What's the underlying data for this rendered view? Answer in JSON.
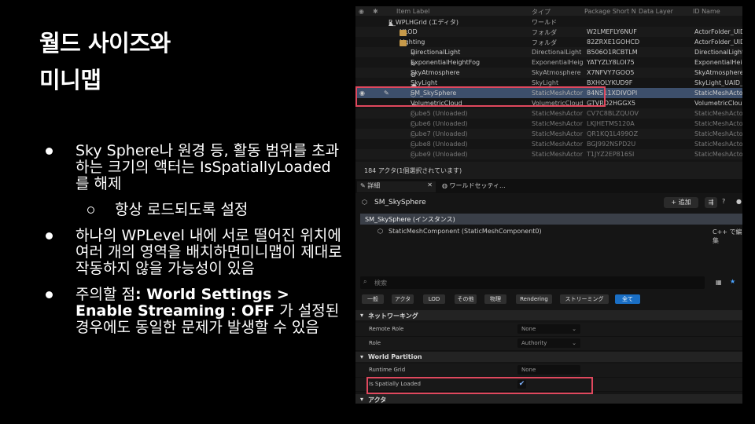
{
  "slide": {
    "title_line1": "월드 사이즈와",
    "title_line2": "미니맵",
    "bullets": [
      {
        "text": "Sky Sphere나 원경 등, 활동 범위를 초과하는 크기의 액터는 IsSpatiallyLoaded를 해제"
      },
      {
        "text": "항상 로드되도록 설정"
      },
      {
        "text": "하나의 WPLevel 내에 서로 떨어진 위치에 여러 개의 영역을 배치하면미니맵이 제대로 작동하지 않을 가능성이 있음"
      },
      {
        "prefix": "주의할 점",
        "bold": ": World Settings > Enable Streaming : OFF",
        "suffix": " 가 설정된 경우에도 동일한 문제가 발생할 수 있음"
      }
    ]
  },
  "editor": {
    "outliner": {
      "headers": {
        "label": "Item Label",
        "type": "タイプ",
        "pkg": "Package Short N",
        "layer": "Data Layer",
        "id": "ID Name"
      },
      "rows": [
        {
          "label": "P_WPLHGrid (エディタ)",
          "type": "ワールド",
          "pkg": "",
          "id": "",
          "indent": 1,
          "icon": "world-icon"
        },
        {
          "label": "HLOD",
          "type": "フォルダ",
          "pkg": "W2LMEFLY6NUF",
          "id": "ActorFolder_UID",
          "indent": 2,
          "icon": "folder-icon"
        },
        {
          "label": "Lighting",
          "type": "フォルダ",
          "pkg": "82ZRXE1GOHCD",
          "id": "ActorFolder_UID",
          "indent": 2,
          "icon": "folder-icon"
        },
        {
          "label": "DirectionalLight",
          "type": "DirectionalLight",
          "pkg": "B506O1RCBTLM",
          "id": "DirectionalLight",
          "indent": 3,
          "icon": "light-icon"
        },
        {
          "label": "ExponentialHeightFog",
          "type": "ExponentialHeig",
          "pkg": "YATYZLY8LOI75",
          "id": "ExponentialHeig",
          "indent": 3,
          "icon": "fog-icon"
        },
        {
          "label": "SkyAtmosphere",
          "type": "SkyAtmosphere",
          "pkg": "X7NFVY7GOO5",
          "id": "SkyAtmosphere",
          "indent": 3,
          "icon": "sky-icon"
        },
        {
          "label": "SkyLight",
          "type": "SkyLight",
          "pkg": "BXHOLYKUD9F",
          "id": "SkyLight_UAID_",
          "indent": 3,
          "icon": "skylight-icon"
        },
        {
          "label": "SM_SkySphere",
          "type": "StaticMeshActor",
          "pkg": "84NS11XDIVOPI",
          "id": "StaticMeshActor",
          "indent": 3,
          "icon": "mesh-icon",
          "selected": true
        },
        {
          "label": "VolumetricCloud",
          "type": "VolumetricCloud",
          "pkg": "GTVRD2HGGX5",
          "id": "VolumetricClou",
          "indent": 3,
          "icon": "cloud-icon"
        },
        {
          "label": "Cube5 (Unloaded)",
          "type": "StaticMeshActor",
          "pkg": "CV7C8BLZQUOV",
          "id": "StaticMeshActor",
          "indent": 3,
          "icon": "mesh-icon",
          "unloaded": true
        },
        {
          "label": "Cube6 (Unloaded)",
          "type": "StaticMeshActor",
          "pkg": "LKJHETMS120A",
          "id": "StaticMeshActor",
          "indent": 3,
          "icon": "mesh-icon",
          "unloaded": true
        },
        {
          "label": "Cube7 (Unloaded)",
          "type": "StaticMeshActor",
          "pkg": "QR1KQ1L499OZ",
          "id": "StaticMeshActor",
          "indent": 3,
          "icon": "mesh-icon",
          "unloaded": true
        },
        {
          "label": "Cube8 (Unloaded)",
          "type": "StaticMeshActor",
          "pkg": "BGJ992NSPD2U",
          "id": "StaticMeshActor",
          "indent": 3,
          "icon": "mesh-icon",
          "unloaded": true
        },
        {
          "label": "Cube9 (Unloaded)",
          "type": "StaticMeshActor",
          "pkg": "T1JYZ2EP816SI",
          "id": "StaticMeshActor",
          "indent": 3,
          "icon": "mesh-icon",
          "unloaded": true
        }
      ],
      "status": "184 アクタ(1個選択されています)"
    },
    "tabs": [
      {
        "label": "詳細"
      },
      {
        "label": "ワールドセッティ..."
      }
    ],
    "details": {
      "actor_name": "SM_SkySphere",
      "add_label": "+ 追加",
      "instance_label": "SM_SkySphere (インスタンス)",
      "component_label": "StaticMeshComponent (StaticMeshComponent0)",
      "cpp_label": "C++ で編集",
      "search_placeholder": "検索",
      "filters": [
        "一般",
        "アクタ",
        "LOD",
        "その他",
        "物理",
        "Rendering",
        "ストリーミング",
        "全て"
      ],
      "categories": {
        "network": "ネットワーキング",
        "world_partition": "World Partition",
        "actor": "アクタ"
      },
      "props": {
        "remote_role": {
          "name": "Remote Role",
          "value": "None"
        },
        "role": {
          "name": "Role",
          "value": "Authority"
        },
        "runtime_grid": {
          "name": "Runtime Grid",
          "value": "None"
        },
        "is_spatially_loaded": {
          "name": "Is Spatially Loaded",
          "checked": "✔"
        }
      }
    },
    "colors": {
      "highlight": "#e0485e",
      "selected_row": "#3d4f6b",
      "accent": "#1a6fc5"
    }
  }
}
